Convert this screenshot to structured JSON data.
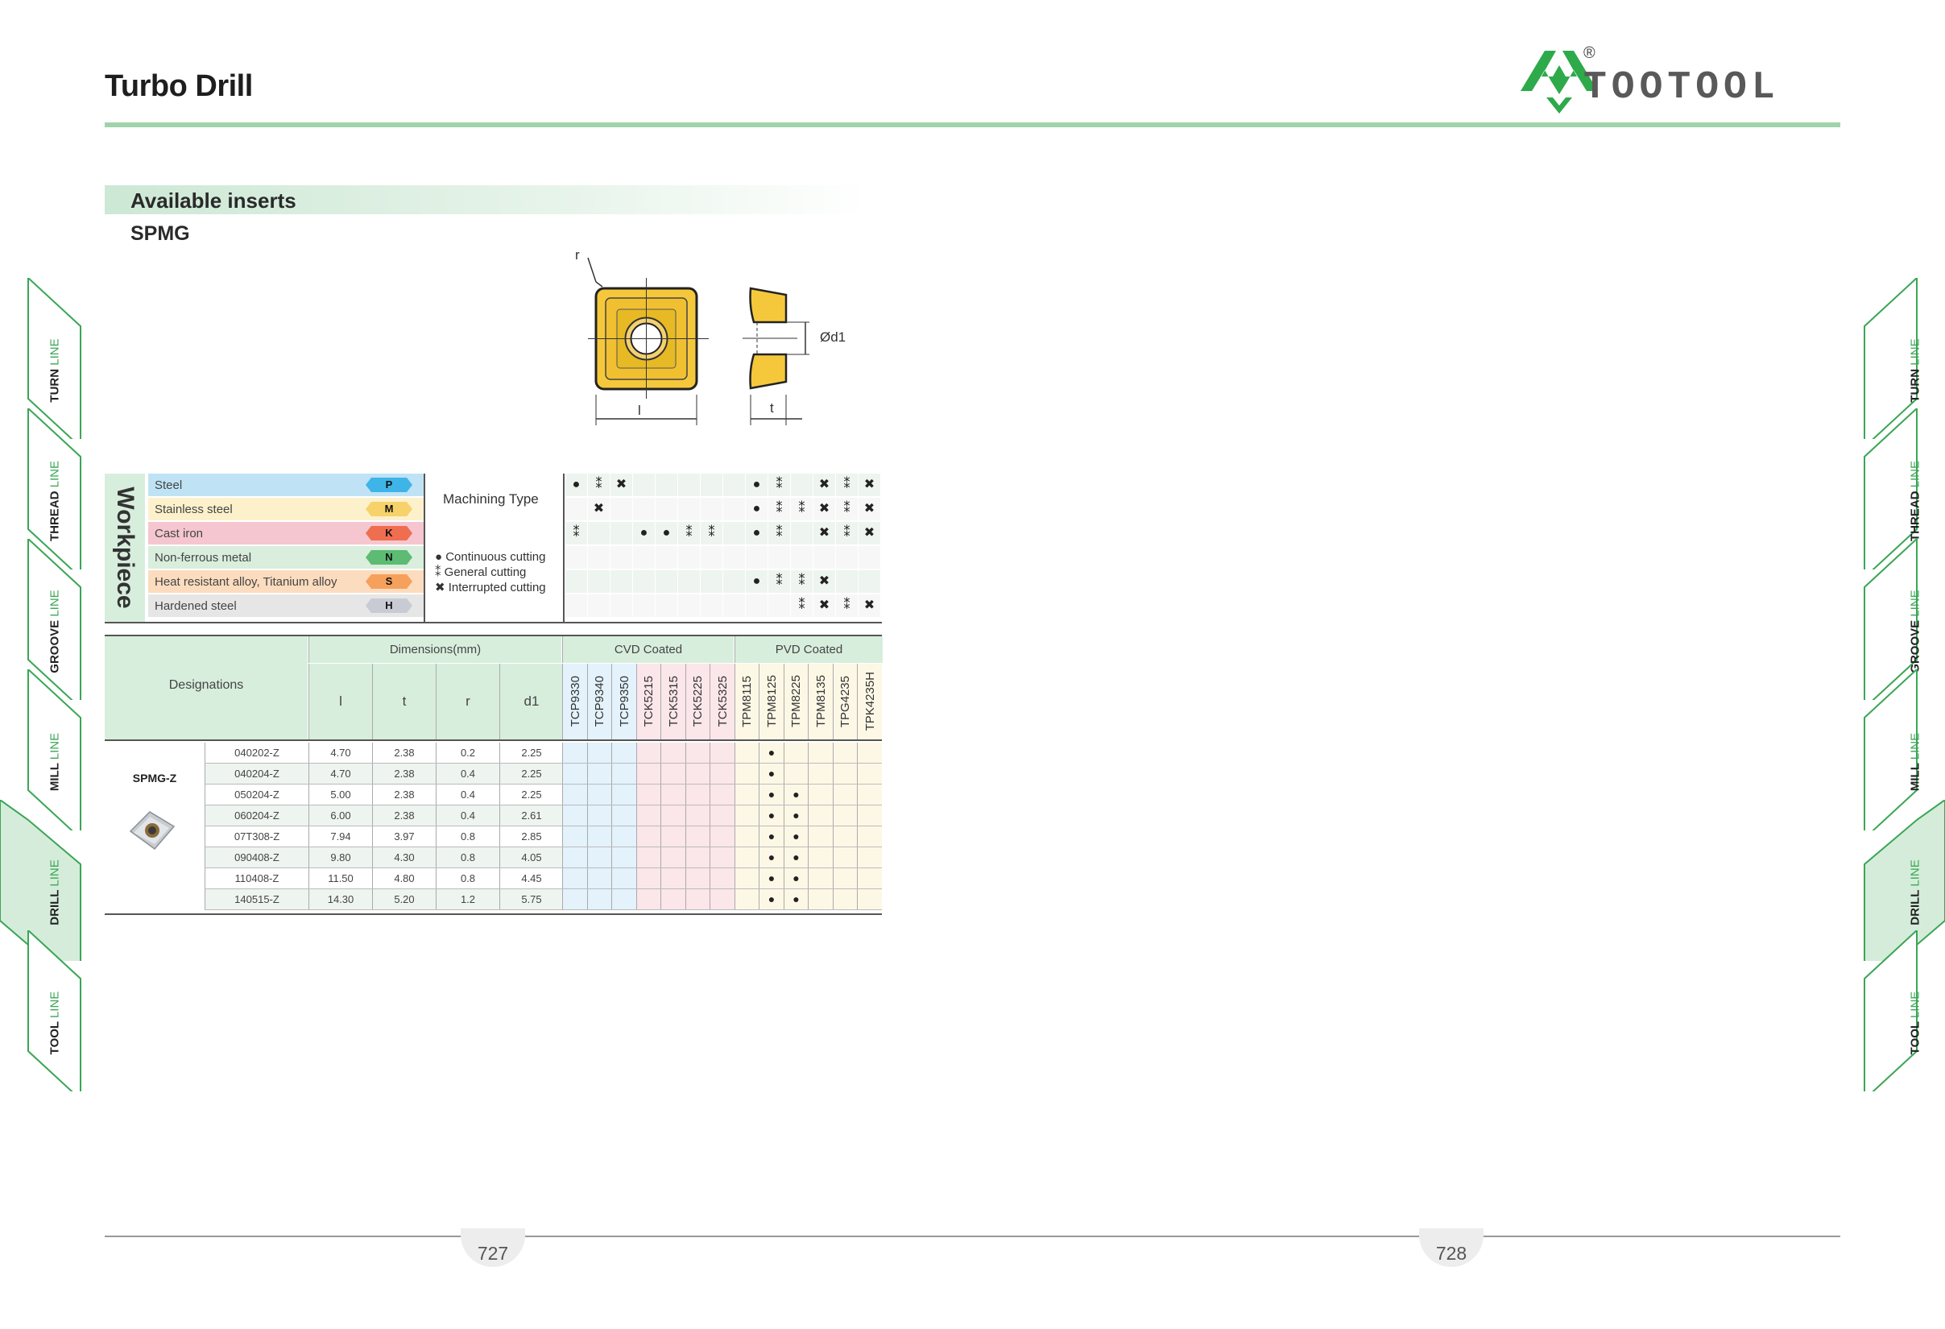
{
  "header": {
    "title": "Turbo Drill",
    "brand": "TOOTOOL",
    "registered": "®"
  },
  "section": {
    "title": "Available inserts",
    "subtitle": "SPMG"
  },
  "diagram": {
    "r": "r",
    "l": "l",
    "t": "t",
    "d1": "Ød1"
  },
  "side_tabs": [
    {
      "main": "TURN",
      "suffix": "LINE",
      "active": false
    },
    {
      "main": "THREAD",
      "suffix": "LINE",
      "active": false
    },
    {
      "main": "GROOVE",
      "suffix": "LINE",
      "active": false
    },
    {
      "main": "MILL",
      "suffix": "LINE",
      "active": false
    },
    {
      "main": "DRILL",
      "suffix": "LINE",
      "active": true
    },
    {
      "main": "TOOL",
      "suffix": "LINE",
      "active": false
    }
  ],
  "workpiece": {
    "heading": "Workpiece",
    "machining_type": "Machining Type",
    "legend": [
      {
        "symbol": "●",
        "text": "Continuous cutting"
      },
      {
        "symbol": "⁑",
        "text": "General cutting"
      },
      {
        "symbol": "✖",
        "text": "Interrupted cutting"
      }
    ],
    "materials": [
      {
        "name": "Steel",
        "code": "P",
        "bg": "#bfe3f5",
        "tag": "#3fb4e8",
        "marks": [
          "●",
          "⁑",
          "✖",
          "",
          "",
          "",
          "",
          "",
          "●",
          "⁑",
          "",
          "✖",
          "⁑",
          "✖"
        ]
      },
      {
        "name": "Stainless steel",
        "code": "M",
        "bg": "#fdf1cc",
        "tag": "#f7d26a",
        "marks": [
          "",
          "✖",
          "",
          "",
          "",
          "",
          "",
          "",
          "●",
          "⁑",
          "⁑",
          "✖",
          "⁑",
          "✖"
        ]
      },
      {
        "name": "Cast iron",
        "code": "K",
        "bg": "#f5c6cf",
        "tag": "#ef6e4f",
        "marks": [
          "⁑",
          "",
          "",
          "●",
          "●",
          "⁑",
          "⁑",
          "",
          "●",
          "⁑",
          "",
          "✖",
          "⁑",
          "✖"
        ]
      },
      {
        "name": "Non-ferrous metal",
        "code": "N",
        "bg": "#d9eedd",
        "tag": "#5dbb73",
        "marks": [
          "",
          "",
          "",
          "",
          "",
          "",
          "",
          "",
          "",
          "",
          "",
          "",
          "",
          ""
        ]
      },
      {
        "name": "Heat resistant alloy, Titanium alloy",
        "code": "S",
        "bg": "#fcdcbf",
        "tag": "#f5a15b",
        "marks": [
          "",
          "",
          "",
          "",
          "",
          "",
          "",
          "",
          "●",
          "⁑",
          "⁑",
          "✖",
          "",
          ""
        ]
      },
      {
        "name": "Hardened steel",
        "code": "H",
        "bg": "#e6e6e6",
        "tag": "#c9cbd4",
        "marks": [
          "",
          "",
          "",
          "",
          "",
          "",
          "",
          "",
          "",
          "",
          "⁑",
          "✖",
          "⁑",
          "✖"
        ]
      }
    ]
  },
  "table": {
    "designations": "Designations",
    "dimensions": "Dimensions(mm)",
    "cvd": "CVD Coated",
    "pvd": "PVD Coated",
    "dim_cols": [
      "l",
      "t",
      "r",
      "d1"
    ],
    "grades": [
      "TCP9330",
      "TCP9340",
      "TCP9350",
      "TCK5215",
      "TCK5315",
      "TCK5225",
      "TCK5325",
      "TPM8115",
      "TPM8125",
      "TPM8225",
      "TPM8135",
      "TPG4235",
      "TPK4235H"
    ],
    "family": "SPMG-Z",
    "rows": [
      {
        "code": "040202-Z",
        "l": "4.70",
        "t": "2.38",
        "r": "0.2",
        "d1": "2.25",
        "marks": [
          "",
          "",
          "",
          "",
          "",
          "",
          "",
          "",
          "●",
          "",
          "",
          "",
          ""
        ]
      },
      {
        "code": "040204-Z",
        "l": "4.70",
        "t": "2.38",
        "r": "0.4",
        "d1": "2.25",
        "marks": [
          "",
          "",
          "",
          "",
          "",
          "",
          "",
          "",
          "●",
          "",
          "",
          "",
          ""
        ]
      },
      {
        "code": "050204-Z",
        "l": "5.00",
        "t": "2.38",
        "r": "0.4",
        "d1": "2.25",
        "marks": [
          "",
          "",
          "",
          "",
          "",
          "",
          "",
          "",
          "●",
          "●",
          "",
          "",
          ""
        ]
      },
      {
        "code": "060204-Z",
        "l": "6.00",
        "t": "2.38",
        "r": "0.4",
        "d1": "2.61",
        "marks": [
          "",
          "",
          "",
          "",
          "",
          "",
          "",
          "",
          "●",
          "●",
          "",
          "",
          ""
        ]
      },
      {
        "code": "07T308-Z",
        "l": "7.94",
        "t": "3.97",
        "r": "0.8",
        "d1": "2.85",
        "marks": [
          "",
          "",
          "",
          "",
          "",
          "",
          "",
          "",
          "●",
          "●",
          "",
          "",
          ""
        ]
      },
      {
        "code": "090408-Z",
        "l": "9.80",
        "t": "4.30",
        "r": "0.8",
        "d1": "4.05",
        "marks": [
          "",
          "",
          "",
          "",
          "",
          "",
          "",
          "",
          "●",
          "●",
          "",
          "",
          ""
        ]
      },
      {
        "code": "110408-Z",
        "l": "11.50",
        "t": "4.80",
        "r": "0.8",
        "d1": "4.45",
        "marks": [
          "",
          "",
          "",
          "",
          "",
          "",
          "",
          "",
          "●",
          "●",
          "",
          "",
          ""
        ]
      },
      {
        "code": "140515-Z",
        "l": "14.30",
        "t": "5.20",
        "r": "1.2",
        "d1": "5.75",
        "marks": [
          "",
          "",
          "",
          "",
          "",
          "",
          "",
          "",
          "●",
          "●",
          "",
          "",
          ""
        ]
      }
    ]
  },
  "pages": {
    "left": "727",
    "right": "728"
  }
}
